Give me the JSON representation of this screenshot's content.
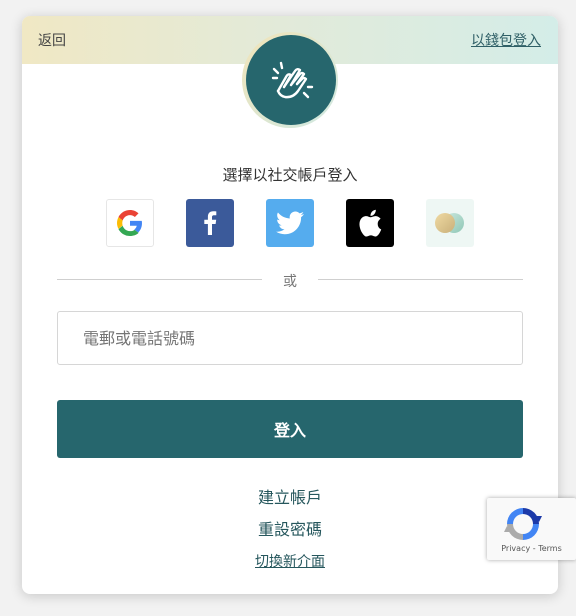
{
  "header": {
    "back_label": "返回",
    "wallet_login_label": "以錢包登入"
  },
  "social": {
    "title": "選擇以社交帳戶登入",
    "providers": [
      {
        "name": "google",
        "icon": "google-icon",
        "color": "#ffffff"
      },
      {
        "name": "facebook",
        "icon": "facebook-icon",
        "color": "#3b5a9a"
      },
      {
        "name": "twitter",
        "icon": "twitter-icon",
        "color": "#55acee"
      },
      {
        "name": "apple",
        "icon": "apple-icon",
        "color": "#000000"
      },
      {
        "name": "wallet",
        "icon": "wallet-icon",
        "color": "#eef7f4"
      }
    ]
  },
  "divider": {
    "or_label": "或"
  },
  "form": {
    "identifier_placeholder": "電郵或電話號碼",
    "identifier_value": "",
    "login_label": "登入"
  },
  "links": {
    "create_account": "建立帳戶",
    "reset_password": "重設密碼",
    "switch_interface": "切換新介面"
  },
  "recaptcha": {
    "privacy_label": "Privacy",
    "separator": " - ",
    "terms_label": "Terms"
  },
  "theme": {
    "primary": "#26666d",
    "link": "#26575d"
  }
}
